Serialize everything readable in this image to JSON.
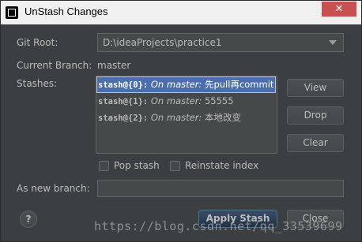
{
  "window": {
    "title": "UnStash Changes",
    "close_label": "✕"
  },
  "labels": {
    "git_root": "Git Root:",
    "current_branch": "Current Branch:",
    "current_branch_value": "master",
    "stashes": "Stashes:",
    "new_branch": "As new branch:"
  },
  "git_root": {
    "value": "D:\\ideaProjects\\practice1"
  },
  "stashes": [
    {
      "ref": "stash@{0}:",
      "branch": "On master:",
      "message": "先pull再commit",
      "selected": true
    },
    {
      "ref": "stash@{1}:",
      "branch": "On master:",
      "message": "55555",
      "selected": false
    },
    {
      "ref": "stash@{2}:",
      "branch": "On master:",
      "message": "本地改变",
      "selected": false
    }
  ],
  "buttons": {
    "view": "View",
    "drop": "Drop",
    "clear": "Clear",
    "apply": "Apply Stash",
    "close": "Close",
    "help": "?"
  },
  "options": {
    "pop_stash": "Pop stash",
    "reinstate_index": "Reinstate index"
  },
  "new_branch": {
    "value": ""
  },
  "watermark": "https://blog.csdn.net/qq_33539699"
}
